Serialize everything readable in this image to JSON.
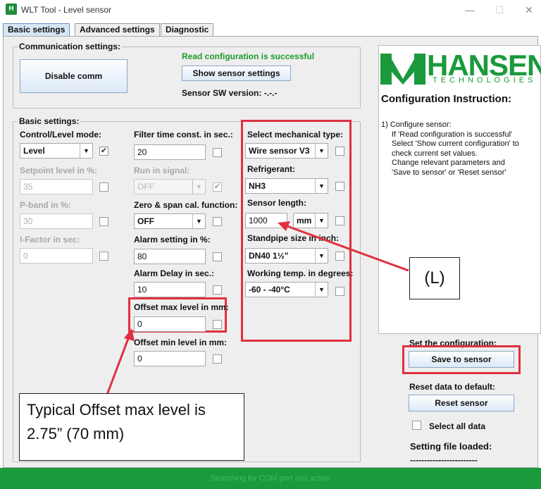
{
  "window": {
    "title": "WLT Tool - Level sensor",
    "icon": "app-icon"
  },
  "tabs": [
    {
      "label": "Basic settings"
    },
    {
      "label": "Advanced settings"
    },
    {
      "label": "Diagnostic"
    }
  ],
  "comm": {
    "group_title": "Communication settings:",
    "disable_btn": "Disable comm",
    "status": "Read configuration is successful",
    "show_btn": "Show sensor settings",
    "sw_version": "Sensor SW version: -.-.-"
  },
  "basic": {
    "group_title": "Basic settings:",
    "control_mode": {
      "label": "Control/Level mode:",
      "value": "Level"
    },
    "setpoint": {
      "label": "Setpoint level in %:",
      "value": "35"
    },
    "pband": {
      "label": "P-band in %:",
      "value": "30"
    },
    "ifactor": {
      "label": "I-Factor in sec:",
      "value": "0"
    },
    "filter": {
      "label": "Filter time const. in sec.:",
      "value": "20"
    },
    "runin": {
      "label": "Run in signal:",
      "value": "OFF"
    },
    "zerospan": {
      "label": "Zero & span cal. function:",
      "value": "OFF"
    },
    "alarm": {
      "label": "Alarm setting in %:",
      "value": "80"
    },
    "alarm_delay": {
      "label": "Alarm Delay in sec.:",
      "value": "10"
    },
    "offset_max": {
      "label": "Offset max level in mm:",
      "value": "0"
    },
    "offset_min": {
      "label": "Offset min level in mm:",
      "value": "0"
    },
    "mech_type": {
      "label": "Select mechanical type:",
      "value": "Wire sensor V3"
    },
    "refrigerant": {
      "label": "Refrigerant:",
      "value": "NH3"
    },
    "sensor_length": {
      "label": "Sensor length:",
      "value": "1000",
      "unit": "mm"
    },
    "standpipe": {
      "label": "Standpipe size in inch:",
      "value": "DN40 1½\""
    },
    "working_temp": {
      "label": "Working temp. in degrees:",
      "value": "-60 - -40°C"
    }
  },
  "brand": {
    "name": "HANSEN",
    "sub": "TECHNOLOGIES",
    "color": "#1a9a3c"
  },
  "instructions": {
    "title": "Configuration Instruction:",
    "lines": [
      "1) Configure sensor:",
      "If 'Read configuration is successful'",
      "Select 'Show current configuration' to",
      "check current set values.",
      "Change relevant parameters and",
      "'Save to sensor' or 'Reset sensor'"
    ]
  },
  "actions": {
    "set_label": "Set the configuration:",
    "save_btn": "Save to sensor",
    "reset_label": "Reset data to default:",
    "reset_btn": "Reset sensor",
    "select_all": "Select all data",
    "file_loaded": "Setting file loaded:",
    "file_value": "------------------------"
  },
  "status": {
    "text": "Searching for COM port and active"
  },
  "annotations": {
    "callout_L": "(L)",
    "callout_offset": "Typical Offset max level is 2.75” (70 mm)",
    "highlight_color": "#e03040"
  }
}
